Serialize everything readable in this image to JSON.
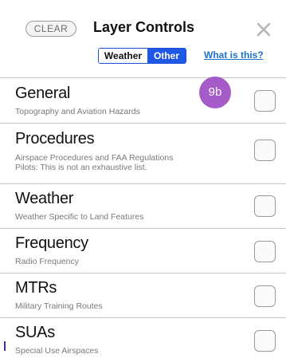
{
  "header": {
    "clear_label": "CLEAR",
    "title": "Layer Controls",
    "close_icon": "close-icon",
    "toggle": {
      "weather_label": "Weather",
      "other_label": "Other",
      "selected": "Other"
    },
    "help_link": "What is this?"
  },
  "badge": {
    "label": "9b",
    "color": "#a55cc9"
  },
  "layers": [
    {
      "title": "General",
      "subtitle": "Topography and Aviation Hazards",
      "checked": false
    },
    {
      "title": "Procedures",
      "subtitle": "Airspace Procedures and FAA Regulations",
      "subtitle2": "Pilots: This is not an exhaustive list.",
      "checked": false
    },
    {
      "title": "Weather",
      "subtitle": "Weather Specific to Land Features",
      "checked": false
    },
    {
      "title": "Frequency",
      "subtitle": "Radio Frequency",
      "checked": false
    },
    {
      "title": "MTRs",
      "subtitle": "Military Training Routes",
      "checked": false
    },
    {
      "title": "SUAs",
      "subtitle": "Special Use Airspaces",
      "checked": false
    }
  ],
  "colors": {
    "accent": "#1f57e6",
    "link": "#1f72c9",
    "divider": "#c8c8c8"
  }
}
